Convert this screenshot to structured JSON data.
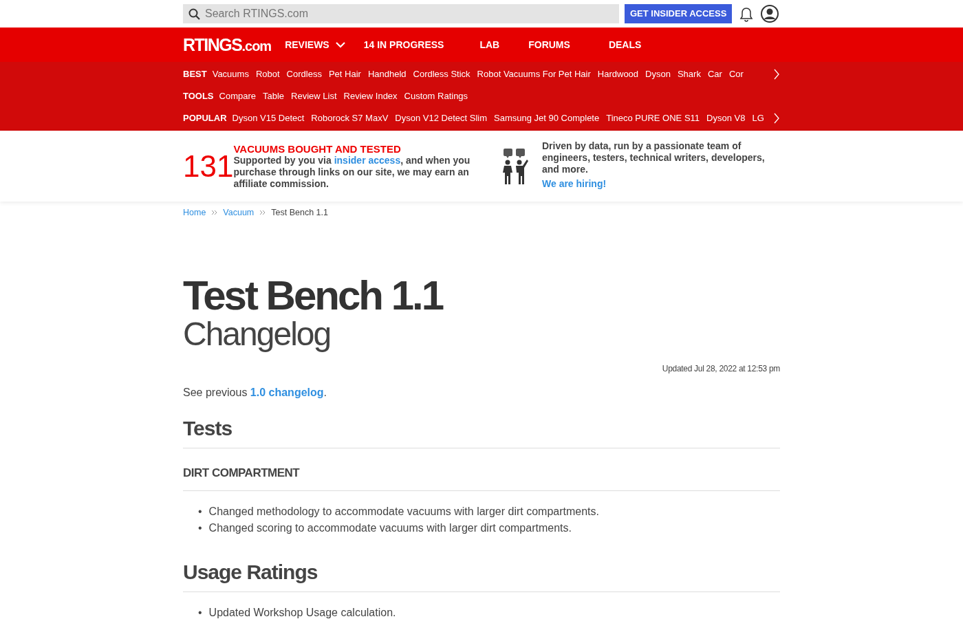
{
  "search": {
    "placeholder": "Search RTINGS.com"
  },
  "insider_button": "GET INSIDER ACCESS",
  "logo": {
    "main": "RTINGS",
    "suffix": ".com"
  },
  "main_nav": [
    {
      "label": "REVIEWS",
      "dropdown": true
    },
    {
      "label": "14 IN PROGRESS",
      "dropdown": false
    },
    {
      "label": "LAB",
      "dropdown": false
    },
    {
      "label": "FORUMS",
      "dropdown": false
    },
    {
      "label": "DEALS",
      "dropdown": false
    }
  ],
  "sub_nav": [
    {
      "heading": "BEST",
      "links": [
        "Vacuums",
        "Robot",
        "Cordless",
        "Pet Hair",
        "Handheld",
        "Cordless Stick",
        "Robot Vacuums For Pet Hair",
        "Hardwood",
        "Dyson",
        "Shark",
        "Car",
        "Cor"
      ],
      "more": true
    },
    {
      "heading": "TOOLS",
      "links": [
        "Compare",
        "Table",
        "Review List",
        "Review Index",
        "Custom Ratings"
      ],
      "more": false
    },
    {
      "heading": "POPULAR",
      "links": [
        "Dyson V15 Detect",
        "Roborock S7 MaxV",
        "Dyson V12 Detect Slim",
        "Samsung Jet 90 Complete",
        "Tineco PURE ONE S11",
        "Dyson V8",
        "LG"
      ],
      "more": true
    }
  ],
  "banner": {
    "count": "131",
    "headline": "VACUUMS BOUGHT AND TESTED",
    "text_before": "Supported by you via ",
    "link": "insider access",
    "text_after": ", and when you purchase through links on our site, we may earn an affiliate commission.",
    "team_text": "Driven by data, run by a passionate team of engineers, testers, technical writers, developers, and more.",
    "team_link": "We are hiring!"
  },
  "breadcrumbs": [
    "Home",
    "Vacuum",
    "Test Bench 1.1"
  ],
  "title": "Test Bench 1.1",
  "subtitle": "Changelog",
  "updated": "Updated Jul 28, 2022 at 12:53 pm",
  "intro": {
    "before": "See previous ",
    "link": "1.0 changelog",
    "after": "."
  },
  "sections": [
    {
      "heading": "Tests",
      "subsections": [
        {
          "heading": "DIRT COMPARTMENT",
          "bullet": "•",
          "items": [
            "Changed methodology to accommodate vacuums with larger dirt compartments.",
            "Changed scoring to accommodate vacuums with larger dirt compartments."
          ]
        }
      ]
    },
    {
      "heading": "Usage Ratings",
      "subsections": [
        {
          "bullet": "•",
          "items": [
            "Updated Workshop Usage calculation."
          ]
        }
      ]
    }
  ]
}
